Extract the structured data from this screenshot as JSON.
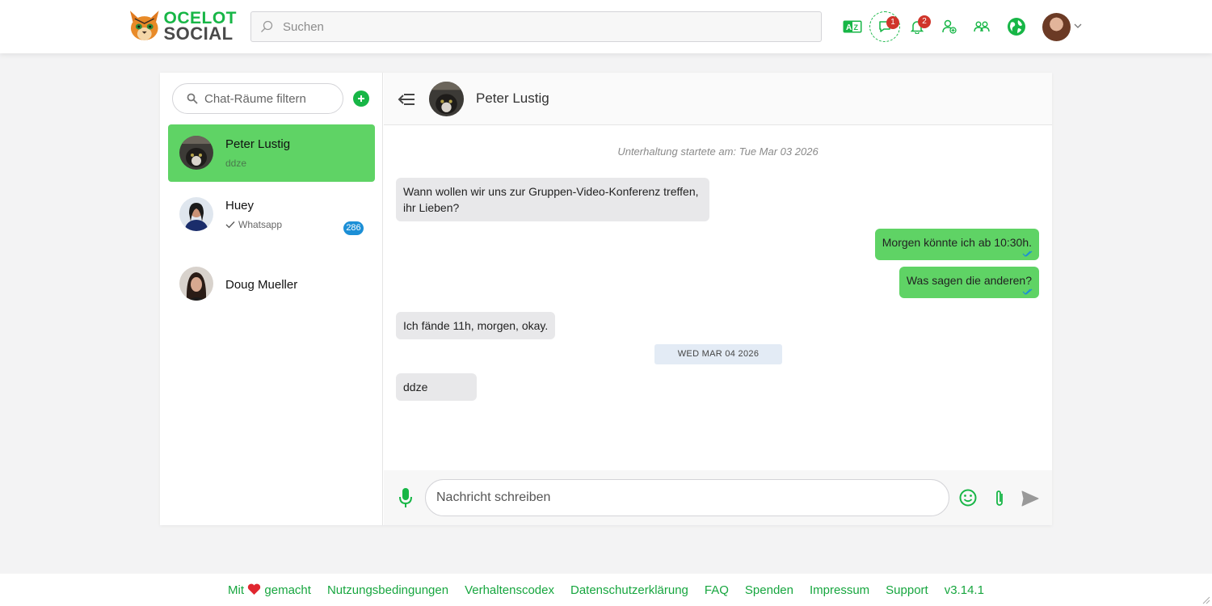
{
  "header": {
    "logo": {
      "line1": "OCELOT",
      "line2": "SOCIAL"
    },
    "search_placeholder": "Suchen",
    "icons": [
      "language-icon",
      "chat-icon",
      "bell-icon",
      "user-plus-icon",
      "groups-icon",
      "map-globe-icon",
      "avatar"
    ],
    "chat_badge": "1",
    "notification_badge": "2"
  },
  "rooms": {
    "filter_placeholder": "Chat-Räume filtern",
    "items": [
      {
        "name": "Peter Lustig",
        "last": "ddze",
        "active": true
      },
      {
        "name": "Huey",
        "last": "Whatsapp",
        "unread": "286"
      },
      {
        "name": "Doug Mueller",
        "last": ""
      }
    ]
  },
  "chat": {
    "title": "Peter Lustig",
    "started": "Unterhaltung startete am: Tue Mar 03 2026",
    "messages": [
      {
        "text": "Wann wollen wir uns zur Gruppen-Video-Konferenz treffen, ihr Lieben?",
        "dir": "in"
      },
      {
        "text": "Morgen könnte ich ab 10:30h.",
        "dir": "out"
      },
      {
        "text": "Was sagen die anderen?",
        "dir": "out"
      },
      {
        "text": "Ich fände 11h, morgen, okay.",
        "dir": "in"
      },
      {
        "text": "ddze",
        "dir": "in"
      }
    ],
    "date_chip": "WED MAR 04 2026",
    "input_placeholder": "Nachricht schreiben"
  },
  "footer": {
    "made_prefix": "Mit",
    "made_suffix": "gemacht",
    "links": [
      "Nutzungsbedingungen",
      "Verhaltenscodex",
      "Datenschutzerklärung",
      "FAQ",
      "Spenden",
      "Impressum",
      "Support",
      "v3.14.1"
    ]
  },
  "colors": {
    "brand_green": "#17b646",
    "bubble_green": "#5fd365",
    "badge_red": "#d0352a",
    "badge_blue": "#1c8fd6",
    "heart": "#e0262f"
  }
}
